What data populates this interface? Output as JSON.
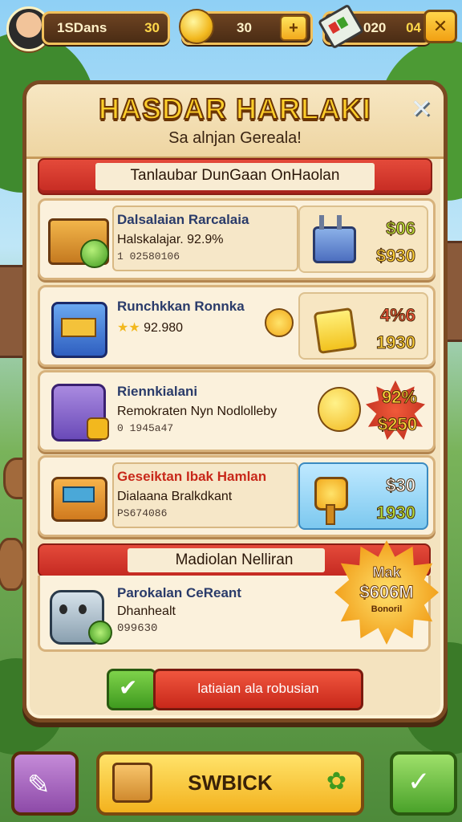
{
  "hud": {
    "player_name": "1SDans",
    "player_value": "30",
    "coins_value": "30",
    "gems_label": "020",
    "gems_value": "04"
  },
  "panel": {
    "title": "HASDAR HARLAKI",
    "subtitle": "Sa alnjan Gereala!",
    "section_title": "Tanlaubar DunGaan OnHaolan"
  },
  "items": [
    {
      "name": "Dalsalaian Rarcalaia",
      "line2": "Halskalajar. 92.9%",
      "line3": "1 02580106",
      "price_top": "$06",
      "price_bottom": "$930",
      "price_top_color": "#b7e23a",
      "price_bottom_color": "#ffd43a"
    },
    {
      "name": "Runchkkan Ronnka",
      "line2": "92.980",
      "line3": "",
      "price_top": "4%6",
      "price_bottom": "1930",
      "price_top_color": "#f0533a",
      "price_bottom_color": "#ffd43a"
    },
    {
      "name": "Riennkialani",
      "line2": "Remokraten Nyn Nodlolleby",
      "line3": "0 1945a47",
      "price_top": "92%",
      "price_bottom": "$250",
      "price_top_color": "#ffd43a",
      "price_bottom_color": "#ffd43a"
    },
    {
      "name": "Geseiktan Ibak Hamlan",
      "line2": "Dialaana Bralkdkant",
      "line3": "PS674086",
      "price_top": "$30",
      "price_bottom": "1930",
      "price_top_color": "#ffffff",
      "price_bottom_color": "#b7e23a"
    }
  ],
  "featured": {
    "title": "Madiolan Nelliran",
    "name": "Parokalan CeReant",
    "line2": "Dhanhealt",
    "line3": "099630",
    "burst_top": "Mak",
    "burst_value": "$606M",
    "burst_bottom": "Bonoril"
  },
  "confirm_label": "latiaian ala robusian",
  "bottom": {
    "mid_label": "SWBICK"
  },
  "colors": {
    "panel_bg": "#f4e3bf",
    "panel_border": "#7a4a22",
    "ribbon_red": "#d33a2c",
    "confirm_red": "#d83a26",
    "confirm_green": "#4aa22a"
  }
}
